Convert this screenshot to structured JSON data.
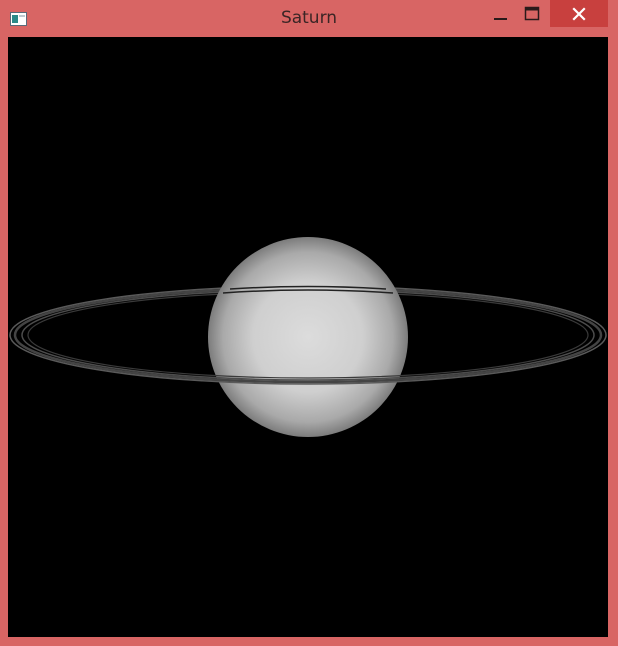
{
  "window": {
    "title": "Saturn",
    "frame_color": "#d86564",
    "close_button_color": "#c8403e",
    "icons": {
      "app": "app-window-icon",
      "minimize": "minimize-icon",
      "maximize": "maximize-icon",
      "close": "close-icon"
    }
  },
  "scene": {
    "background": "#000000",
    "objects": [
      "planet-sphere",
      "planet-rings"
    ]
  }
}
